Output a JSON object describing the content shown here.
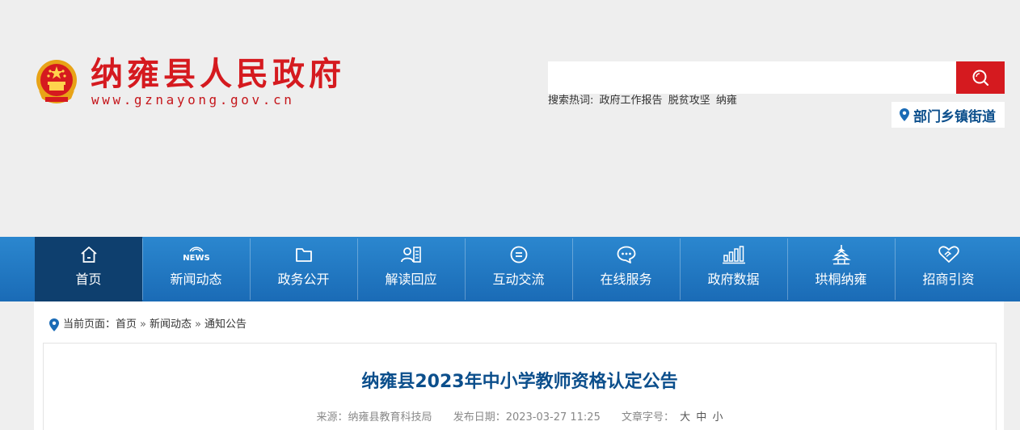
{
  "header": {
    "site_title": "纳雍县人民政府",
    "site_url": "www.gznayong.gov.cn",
    "search": {
      "placeholder": ""
    },
    "hotwords": {
      "label": "搜索热词:",
      "items": [
        "政府工作报告",
        "脱贫攻坚",
        "纳雍"
      ]
    },
    "dept_link": "部门乡镇街道"
  },
  "nav": {
    "items": [
      {
        "label": "首页",
        "icon": "home-icon",
        "active": true
      },
      {
        "label": "新闻动态",
        "icon": "news-icon",
        "icon_text": "NEWS"
      },
      {
        "label": "政务公开",
        "icon": "folder-icon"
      },
      {
        "label": "解读回应",
        "icon": "interpret-icon"
      },
      {
        "label": "互动交流",
        "icon": "chat-icon"
      },
      {
        "label": "在线服务",
        "icon": "service-bubble-icon"
      },
      {
        "label": "政府数据",
        "icon": "bar-chart-icon"
      },
      {
        "label": "珙桐纳雍",
        "icon": "tower-icon"
      },
      {
        "label": "招商引资",
        "icon": "handshake-heart-icon"
      }
    ]
  },
  "breadcrumb": {
    "label": "当前页面：",
    "items": [
      "首页",
      "新闻动态",
      "通知公告"
    ],
    "separator": "»"
  },
  "article": {
    "title": "纳雍县2023年中小学教师资格认定公告",
    "source": "来源：纳雍县教育科技局",
    "date": "发布日期：2023-03-27 11:25",
    "fontsize_label": "文章字号：",
    "fontsize_options": [
      "大",
      "中",
      "小"
    ]
  },
  "colors": {
    "brand_red": "#d51a1f",
    "nav_blue": "#1a6bb6",
    "nav_active": "#0e3f6e",
    "title_blue": "#0c4f8c"
  }
}
